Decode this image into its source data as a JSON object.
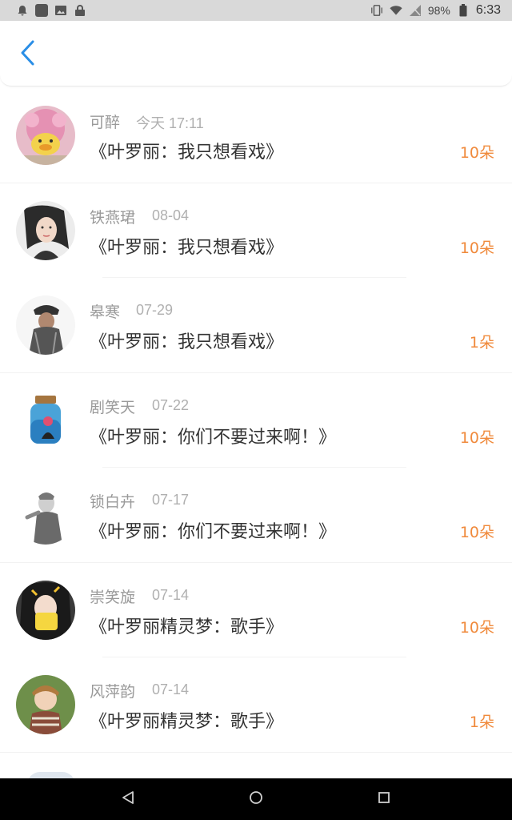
{
  "status_bar": {
    "battery": "98%",
    "time": "6:33"
  },
  "header": {
    "back_icon": "chevron-left-icon",
    "accent": "#2a8ee6"
  },
  "colors": {
    "count": "#f08a3c",
    "name": "#9a9a9a",
    "title": "#333333"
  },
  "gifts": [
    {
      "name": "可醉",
      "date": "今天 17:11",
      "title": "《叶罗丽：我只想看戏》",
      "count": "10朵"
    },
    {
      "name": "铁燕珺",
      "date": "08-04",
      "title": "《叶罗丽：我只想看戏》",
      "count": "10朵"
    },
    {
      "name": "皋寒",
      "date": "07-29",
      "title": "《叶罗丽：我只想看戏》",
      "count": "1朵"
    },
    {
      "name": "剧笑天",
      "date": "07-22",
      "title": "《叶罗丽：你们不要过来啊！》",
      "count": "10朵"
    },
    {
      "name": "锁白卉",
      "date": "07-17",
      "title": "《叶罗丽：你们不要过来啊！》",
      "count": "10朵"
    },
    {
      "name": "崇笑旋",
      "date": "07-14",
      "title": "《叶罗丽精灵梦：歌手》",
      "count": "10朵"
    },
    {
      "name": "风萍韵",
      "date": "07-14",
      "title": "《叶罗丽精灵梦：歌手》",
      "count": "1朵"
    }
  ],
  "nav": {
    "back_icon": "triangle-back-icon",
    "home_icon": "circle-home-icon",
    "recents_icon": "square-recents-icon"
  }
}
